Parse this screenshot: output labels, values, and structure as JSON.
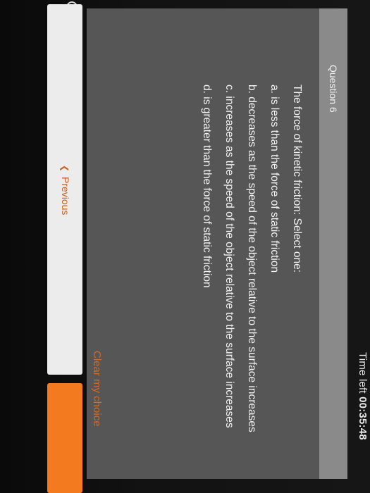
{
  "timer": {
    "label": "Time left",
    "value": "00:35:48"
  },
  "question": {
    "number_label": "Question 6",
    "prompt": "The force of kinetic friction: Select one:",
    "options": [
      {
        "letter": "a.",
        "text": "is less than the force of static friction"
      },
      {
        "letter": "b.",
        "text": "decreases as the speed of the object relative to the surface increases"
      },
      {
        "letter": "c.",
        "text": "increases as the speed of the object relative to the surface increases"
      },
      {
        "letter": "d.",
        "text": "is greater than the force of static friction"
      }
    ],
    "clear_label": "Clear my choice"
  },
  "navigation": {
    "previous_label": "Previous",
    "previous_icon": "chevron-left-icon",
    "next_color": "#f47a20"
  },
  "colors": {
    "accent": "#f47a20",
    "link": "#d86a20",
    "card_bg": "#565656",
    "header_bg": "#8a8a8a"
  }
}
